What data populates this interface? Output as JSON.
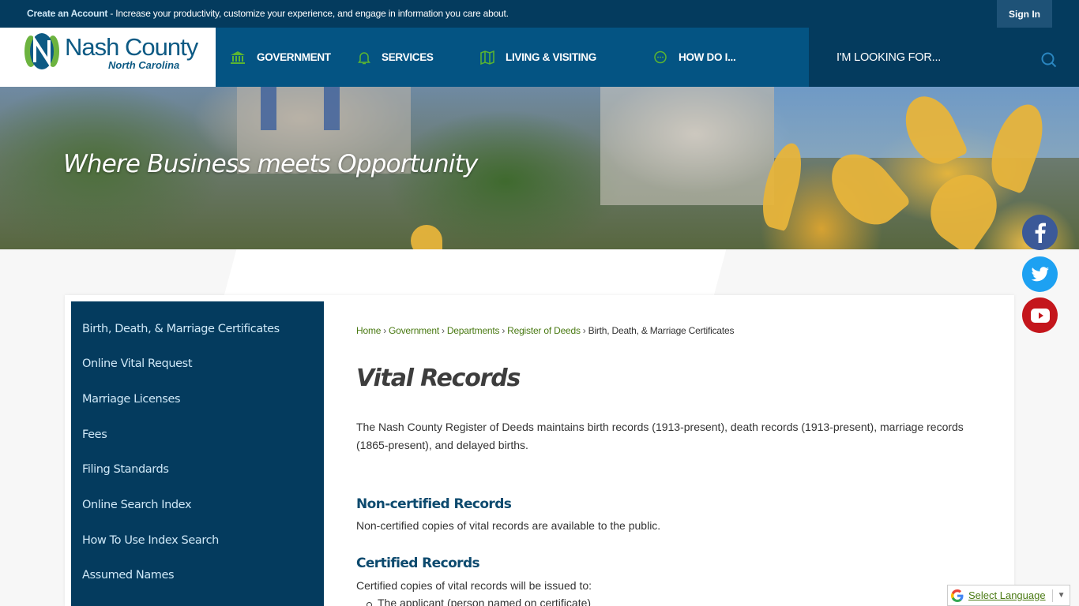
{
  "topbar": {
    "create_account_link": "Create an Account",
    "promo_text": " - Increase your productivity, customize your experience, and engage in information you care about.",
    "sign_in": "Sign In"
  },
  "logo": {
    "name": "Nash County",
    "subtitle": "North Carolina"
  },
  "nav": [
    {
      "label": "GOVERNMENT",
      "icon": "government-building-icon"
    },
    {
      "label": "SERVICES",
      "icon": "bell-icon"
    },
    {
      "label": "LIVING & VISITING",
      "icon": "map-icon"
    },
    {
      "label": "HOW DO I...",
      "icon": "chat-bubble-icon"
    }
  ],
  "search": {
    "placeholder": "I'M LOOKING FOR..."
  },
  "hero": {
    "tagline": "Where Business meets Opportunity"
  },
  "social": [
    {
      "name": "Facebook",
      "color": "#3b5998"
    },
    {
      "name": "Twitter",
      "color": "#1da1f2"
    },
    {
      "name": "YouTube",
      "color": "#c4161c"
    }
  ],
  "sidebar": {
    "items": [
      {
        "label": "Birth, Death, & Marriage Certificates"
      },
      {
        "label": "Online Vital Request"
      },
      {
        "label": "Marriage Licenses"
      },
      {
        "label": "Fees"
      },
      {
        "label": "Filing Standards"
      },
      {
        "label": "Online Search Index"
      },
      {
        "label": "How To Use Index Search"
      },
      {
        "label": "Assumed Names"
      }
    ]
  },
  "breadcrumb": {
    "links": [
      "Home",
      "Government",
      "Departments",
      "Register of Deeds"
    ],
    "separator": "›",
    "current": "Birth, Death, & Marriage Certificates"
  },
  "page": {
    "title": "Vital Records",
    "intro": "The Nash County Register of Deeds maintains birth records (1913-present), death records (1913-present), marriage records (1865-present), and delayed births.",
    "sections": [
      {
        "heading": "Non-certified Records",
        "text": "Non-certified copies of vital records are available to the public."
      },
      {
        "heading": "Certified Records",
        "text": "Certified copies of vital records will be issued to:"
      }
    ],
    "list_items": [
      "The applicant (person named on certificate)"
    ]
  },
  "translate": {
    "label": "Select Language",
    "arrow": "▼"
  },
  "colors": {
    "topbar": "#043b5e",
    "nav": "#045483",
    "sidebar": "#043b5e",
    "link_green": "#4a7a13",
    "heading_blue": "#0d4a6e",
    "icon_green": "#5bb531"
  }
}
